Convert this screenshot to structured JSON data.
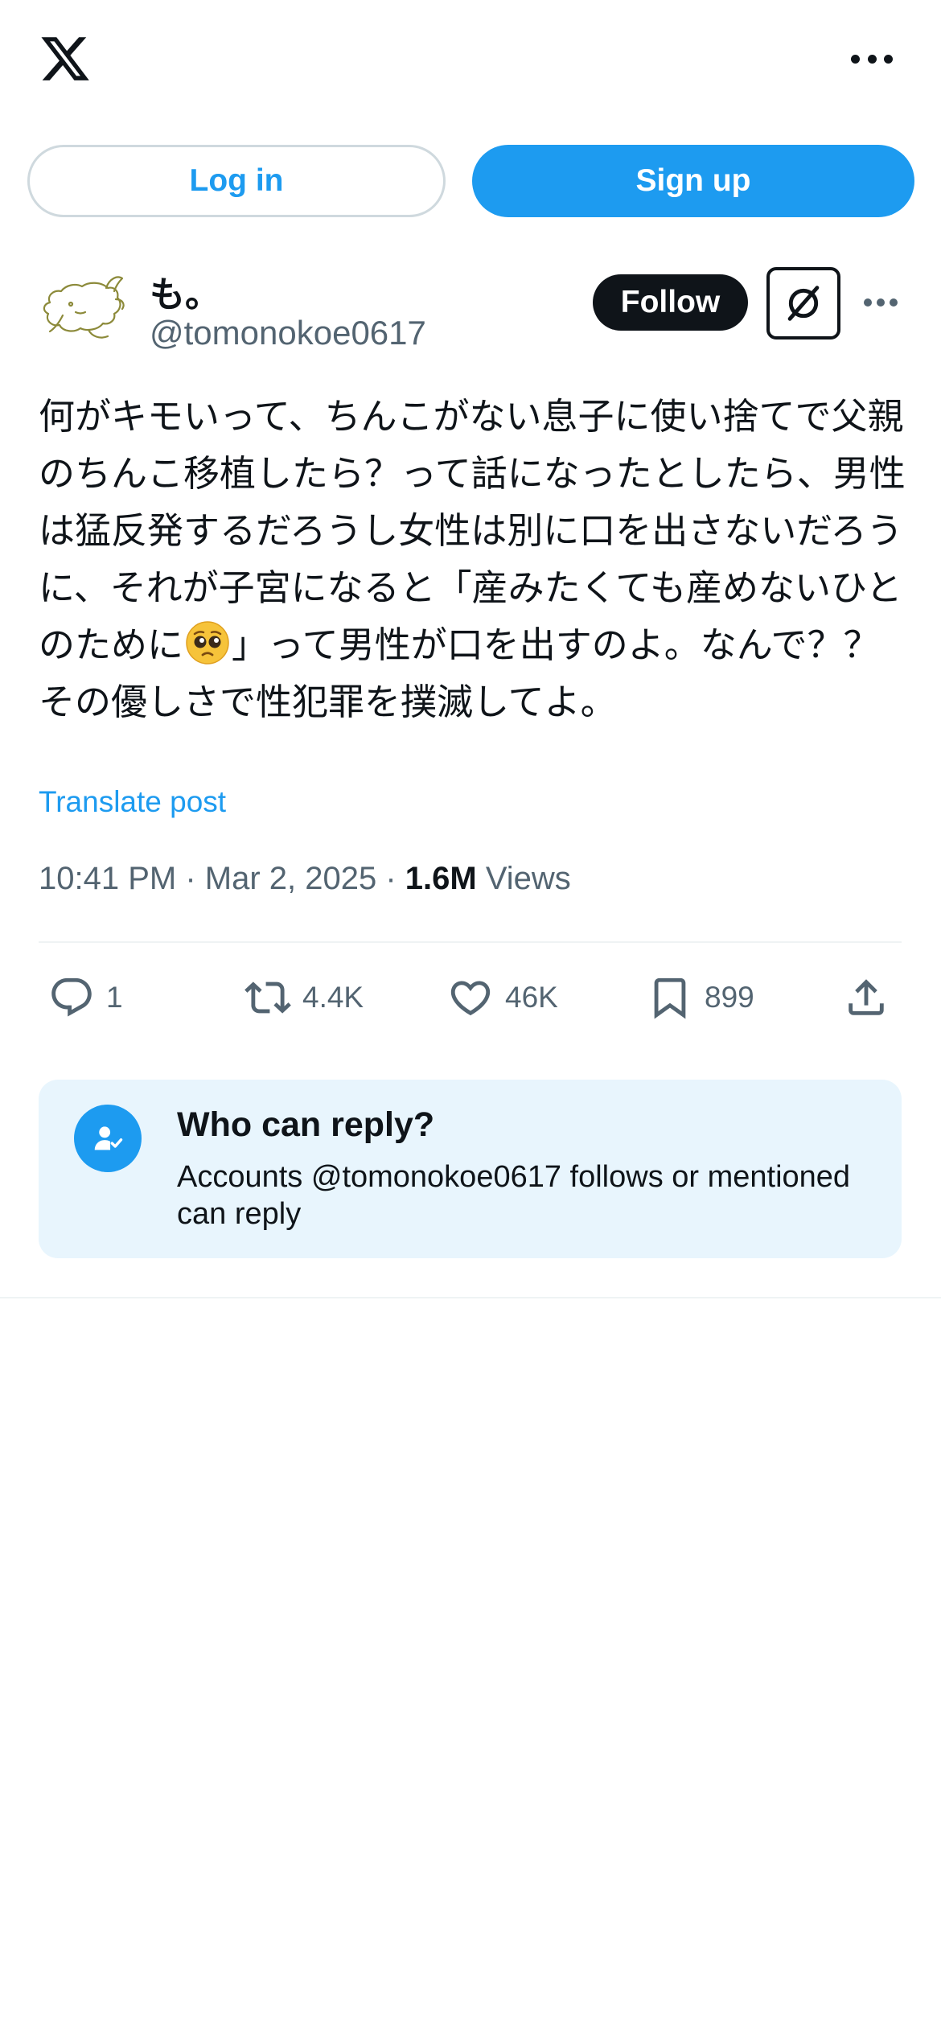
{
  "header": {
    "logo_icon": "x-logo-icon",
    "more_icon": "more-horizontal-icon"
  },
  "auth": {
    "login_label": "Log in",
    "signup_label": "Sign up"
  },
  "tweet": {
    "author": {
      "display_name": "も。",
      "handle": "@tomonokoe0617",
      "avatar_icon": "avatar-cat-drawing"
    },
    "follow_label": "Follow",
    "grok_icon": "grok-icon",
    "more_icon": "more-horizontal-icon",
    "text_part1": "何がキモいって、ちんこがない息子に使い捨てで父親のちんこ移植したら？って話になったとしたら、男性は猛反発するだろうし女性は別に口を出さないだろうに、それが子宮になると「産みたくても産めないひとのために",
    "emoji_icon": "pleading-face-emoji",
    "text_part2": "」って男性が口を出すのよ。なんで？？その優しさで性犯罪を撲滅してよ。",
    "translate_label": "Translate post",
    "time": "10:41 PM",
    "separator": " · ",
    "date": "Mar 2, 2025",
    "views_count": "1.6M",
    "views_label": " Views"
  },
  "actions": {
    "reply_count": "1",
    "repost_count": "4.4K",
    "like_count": "46K",
    "bookmark_count": "899"
  },
  "reply_settings": {
    "title": "Who can reply?",
    "description": "Accounts @tomonokoe0617 follows or mentioned can reply",
    "icon": "person-check-icon"
  },
  "colors": {
    "accent": "#1d9bf0",
    "text_primary": "#0f1419",
    "text_secondary": "#536471",
    "card_background": "#e8f5fd"
  }
}
